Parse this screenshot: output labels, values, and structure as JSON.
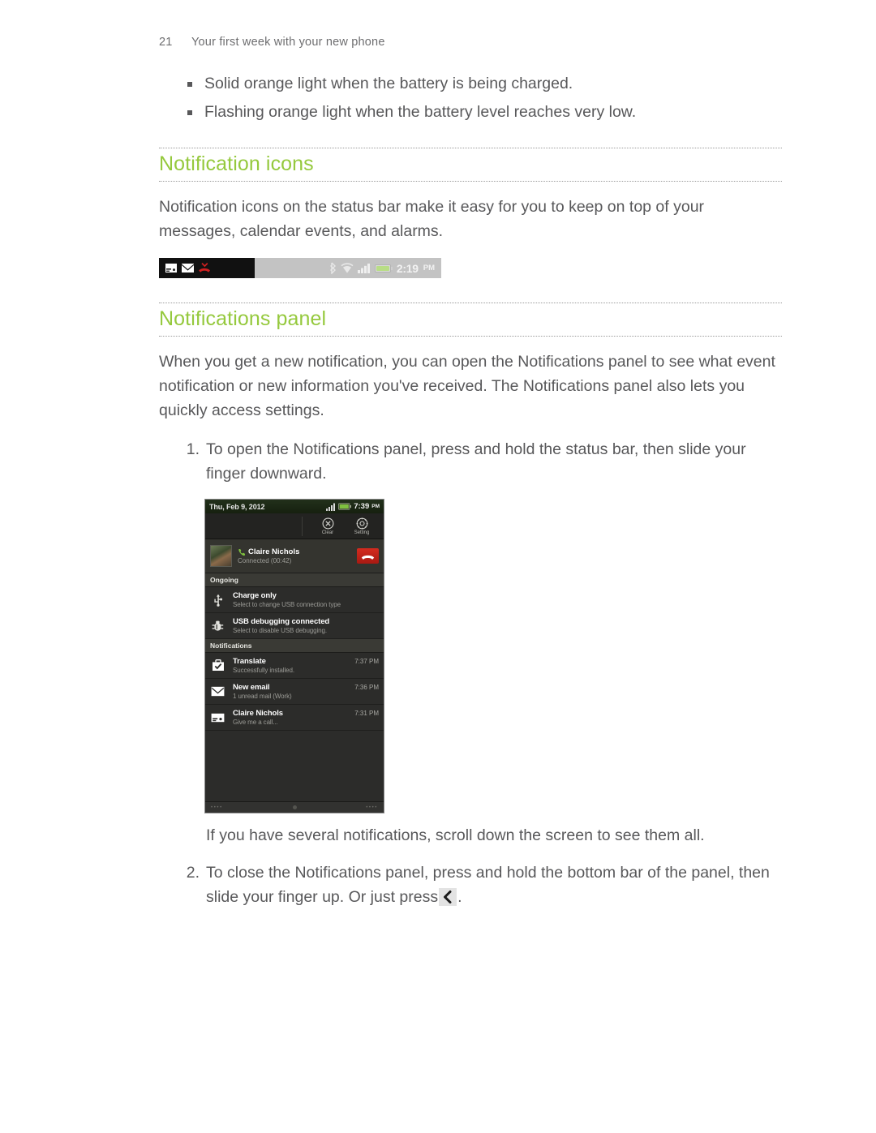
{
  "header": {
    "page_number": "21",
    "title": "Your first week with your new phone"
  },
  "bullets": [
    "Solid orange light when the battery is being charged.",
    "Flashing orange light when the battery level reaches very low."
  ],
  "sections": [
    {
      "heading": "Notification icons",
      "paragraph": "Notification icons on the status bar make it easy for you to keep on top of your messages, calendar events, and alarms."
    },
    {
      "heading": "Notifications panel",
      "paragraph": "When you get a new notification, you can open the Notifications panel to see what event notification or new information you've received. The Notifications panel also lets you quickly access settings."
    }
  ],
  "status_bar_figure": {
    "left_icons": [
      "sms-icon",
      "envelope-icon",
      "missed-call-icon"
    ],
    "right_icons": [
      "bluetooth-icon",
      "wifi-icon",
      "signal-icon",
      "battery-icon"
    ],
    "time": "2:19",
    "ampm": "PM"
  },
  "steps": [
    {
      "number": "1.",
      "text": "To open the Notifications panel, press and hold the status bar, then slide your finger downward."
    },
    {
      "number": "2.",
      "text_before": "To close the Notifications panel, press and hold the bottom bar of the panel, then slide your finger up. Or just press",
      "text_after": "."
    }
  ],
  "note_after_step1": "If you have several notifications, scroll down the screen to see them all.",
  "phone_screenshot": {
    "status_bar": {
      "date": "Thu, Feb 9, 2012",
      "time": "7:39",
      "ampm": "PM",
      "icons": [
        "signal-icon",
        "battery-icon"
      ]
    },
    "toolbar": {
      "clear_label": "Clear",
      "settings_label": "Setting"
    },
    "active_call": {
      "name": "Claire Nichols",
      "status": "Connected (00:42)",
      "end_call_icon": "end-call-icon"
    },
    "ongoing": {
      "header": "Ongoing",
      "items": [
        {
          "icon": "usb-icon",
          "title": "Charge only",
          "subtitle": "Select to change USB connection type"
        },
        {
          "icon": "usb-debug-icon",
          "title": "USB debugging connected",
          "subtitle": "Select to disable USB debugging."
        }
      ]
    },
    "notifications": {
      "header": "Notifications",
      "items": [
        {
          "icon": "install-check-icon",
          "title": "Translate",
          "subtitle": "Successfully installed.",
          "time": "7:37 PM"
        },
        {
          "icon": "envelope-icon",
          "title": "New email",
          "subtitle": "1 unread mail (Work)",
          "time": "7:36 PM"
        },
        {
          "icon": "sms-icon",
          "title": "Claire Nichols",
          "subtitle": "Give me a call...",
          "time": "7:31 PM"
        }
      ]
    },
    "handle_dots": "••••"
  },
  "colors": {
    "heading_green": "#95c93d",
    "body_text": "#58585a",
    "accent_red": "#c1251a"
  }
}
